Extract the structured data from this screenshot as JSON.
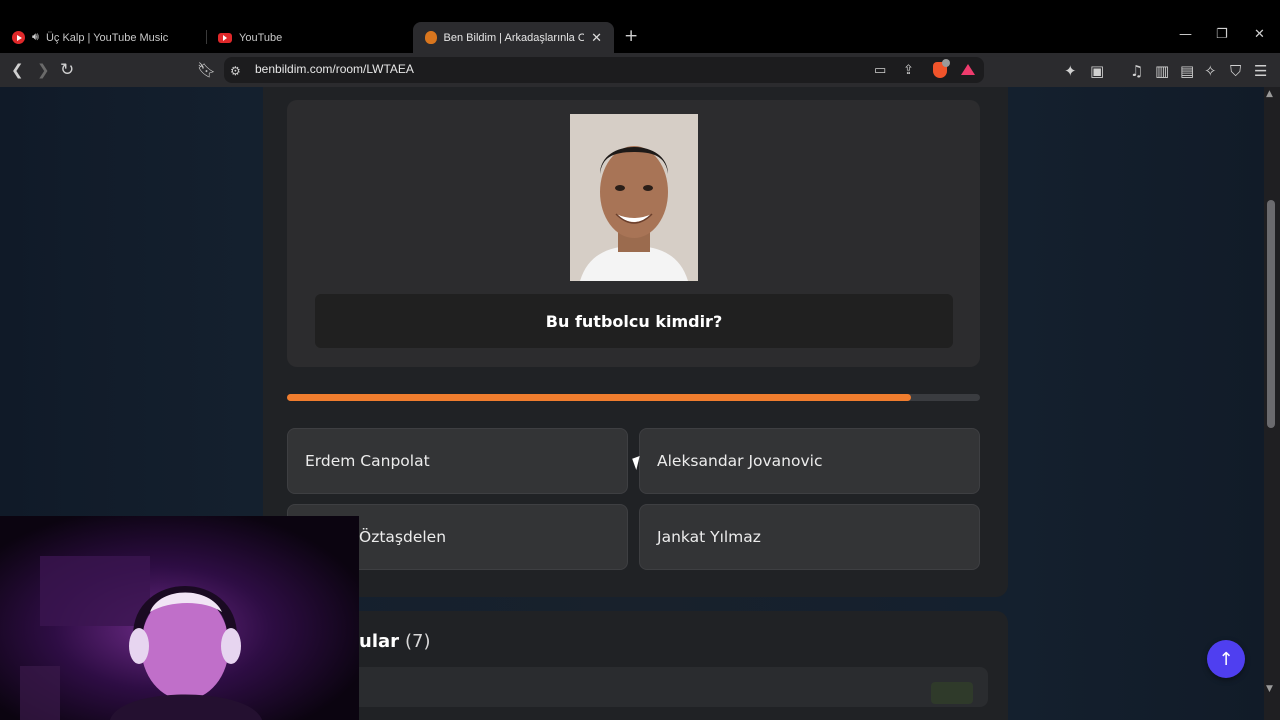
{
  "browser": {
    "tabs": [
      {
        "title": "Üç Kalp | YouTube Music",
        "icon": "youtube-music-icon"
      },
      {
        "title": "YouTube",
        "icon": "youtube-icon"
      },
      {
        "title": "Ben Bildim | Arkadaşlarınla Onlin",
        "icon": "benbildim-icon",
        "active": true
      }
    ],
    "url": "benbildim.com/room/LWTAEA"
  },
  "quiz": {
    "question": "Bu futbolcu kimdir?",
    "time_remaining_fraction": 0.9,
    "options": [
      {
        "label": "Erdem Canpolat"
      },
      {
        "label": "Aleksandar Jovanovic"
      },
      {
        "label": "Öztaşdelen"
      },
      {
        "label": "Jankat Yılmaz"
      }
    ]
  },
  "players": {
    "title": "ular",
    "count": "(7)"
  },
  "colors": {
    "progress": "#f07d2e",
    "scroll_button": "#4f3ff0",
    "card_bg": "#2c2c2e"
  }
}
